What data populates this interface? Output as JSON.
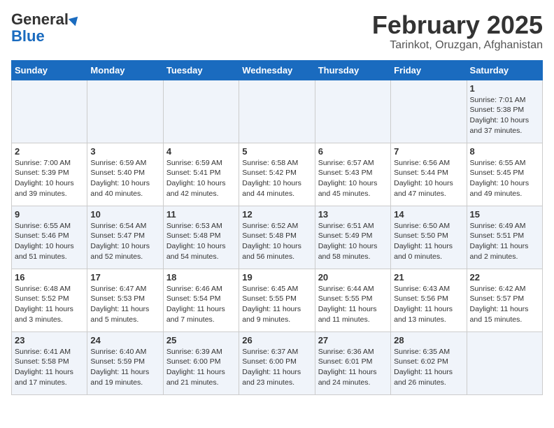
{
  "header": {
    "logo_general": "General",
    "logo_blue": "Blue",
    "title": "February 2025",
    "subtitle": "Tarinkot, Oruzgan, Afghanistan"
  },
  "weekdays": [
    "Sunday",
    "Monday",
    "Tuesday",
    "Wednesday",
    "Thursday",
    "Friday",
    "Saturday"
  ],
  "weeks": [
    [
      {
        "day": "",
        "info": ""
      },
      {
        "day": "",
        "info": ""
      },
      {
        "day": "",
        "info": ""
      },
      {
        "day": "",
        "info": ""
      },
      {
        "day": "",
        "info": ""
      },
      {
        "day": "",
        "info": ""
      },
      {
        "day": "1",
        "info": "Sunrise: 7:01 AM\nSunset: 5:38 PM\nDaylight: 10 hours\nand 37 minutes."
      }
    ],
    [
      {
        "day": "2",
        "info": "Sunrise: 7:00 AM\nSunset: 5:39 PM\nDaylight: 10 hours\nand 39 minutes."
      },
      {
        "day": "3",
        "info": "Sunrise: 6:59 AM\nSunset: 5:40 PM\nDaylight: 10 hours\nand 40 minutes."
      },
      {
        "day": "4",
        "info": "Sunrise: 6:59 AM\nSunset: 5:41 PM\nDaylight: 10 hours\nand 42 minutes."
      },
      {
        "day": "5",
        "info": "Sunrise: 6:58 AM\nSunset: 5:42 PM\nDaylight: 10 hours\nand 44 minutes."
      },
      {
        "day": "6",
        "info": "Sunrise: 6:57 AM\nSunset: 5:43 PM\nDaylight: 10 hours\nand 45 minutes."
      },
      {
        "day": "7",
        "info": "Sunrise: 6:56 AM\nSunset: 5:44 PM\nDaylight: 10 hours\nand 47 minutes."
      },
      {
        "day": "8",
        "info": "Sunrise: 6:55 AM\nSunset: 5:45 PM\nDaylight: 10 hours\nand 49 minutes."
      }
    ],
    [
      {
        "day": "9",
        "info": "Sunrise: 6:55 AM\nSunset: 5:46 PM\nDaylight: 10 hours\nand 51 minutes."
      },
      {
        "day": "10",
        "info": "Sunrise: 6:54 AM\nSunset: 5:47 PM\nDaylight: 10 hours\nand 52 minutes."
      },
      {
        "day": "11",
        "info": "Sunrise: 6:53 AM\nSunset: 5:48 PM\nDaylight: 10 hours\nand 54 minutes."
      },
      {
        "day": "12",
        "info": "Sunrise: 6:52 AM\nSunset: 5:48 PM\nDaylight: 10 hours\nand 56 minutes."
      },
      {
        "day": "13",
        "info": "Sunrise: 6:51 AM\nSunset: 5:49 PM\nDaylight: 10 hours\nand 58 minutes."
      },
      {
        "day": "14",
        "info": "Sunrise: 6:50 AM\nSunset: 5:50 PM\nDaylight: 11 hours\nand 0 minutes."
      },
      {
        "day": "15",
        "info": "Sunrise: 6:49 AM\nSunset: 5:51 PM\nDaylight: 11 hours\nand 2 minutes."
      }
    ],
    [
      {
        "day": "16",
        "info": "Sunrise: 6:48 AM\nSunset: 5:52 PM\nDaylight: 11 hours\nand 3 minutes."
      },
      {
        "day": "17",
        "info": "Sunrise: 6:47 AM\nSunset: 5:53 PM\nDaylight: 11 hours\nand 5 minutes."
      },
      {
        "day": "18",
        "info": "Sunrise: 6:46 AM\nSunset: 5:54 PM\nDaylight: 11 hours\nand 7 minutes."
      },
      {
        "day": "19",
        "info": "Sunrise: 6:45 AM\nSunset: 5:55 PM\nDaylight: 11 hours\nand 9 minutes."
      },
      {
        "day": "20",
        "info": "Sunrise: 6:44 AM\nSunset: 5:55 PM\nDaylight: 11 hours\nand 11 minutes."
      },
      {
        "day": "21",
        "info": "Sunrise: 6:43 AM\nSunset: 5:56 PM\nDaylight: 11 hours\nand 13 minutes."
      },
      {
        "day": "22",
        "info": "Sunrise: 6:42 AM\nSunset: 5:57 PM\nDaylight: 11 hours\nand 15 minutes."
      }
    ],
    [
      {
        "day": "23",
        "info": "Sunrise: 6:41 AM\nSunset: 5:58 PM\nDaylight: 11 hours\nand 17 minutes."
      },
      {
        "day": "24",
        "info": "Sunrise: 6:40 AM\nSunset: 5:59 PM\nDaylight: 11 hours\nand 19 minutes."
      },
      {
        "day": "25",
        "info": "Sunrise: 6:39 AM\nSunset: 6:00 PM\nDaylight: 11 hours\nand 21 minutes."
      },
      {
        "day": "26",
        "info": "Sunrise: 6:37 AM\nSunset: 6:00 PM\nDaylight: 11 hours\nand 23 minutes."
      },
      {
        "day": "27",
        "info": "Sunrise: 6:36 AM\nSunset: 6:01 PM\nDaylight: 11 hours\nand 24 minutes."
      },
      {
        "day": "28",
        "info": "Sunrise: 6:35 AM\nSunset: 6:02 PM\nDaylight: 11 hours\nand 26 minutes."
      },
      {
        "day": "",
        "info": ""
      }
    ]
  ]
}
